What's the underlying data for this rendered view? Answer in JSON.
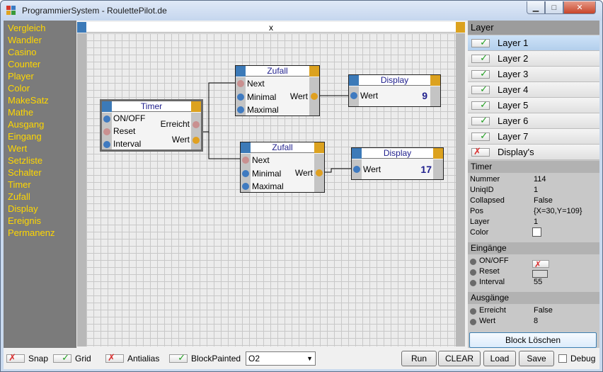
{
  "window": {
    "title": "ProgrammierSystem - RoulettePilot.de",
    "min": "▁",
    "max": "□",
    "close": "✕"
  },
  "palette": [
    "Vergleich",
    "Wandler",
    "Casino",
    "Counter",
    "Player",
    "Color",
    "MakeSatz",
    "Mathe",
    "Ausgang",
    "Eingang",
    "Wert",
    "Setzliste",
    "Schalter",
    "Timer",
    "Zufall",
    "Display",
    "Ereignis",
    "Permanenz"
  ],
  "canvas": {
    "header": "x"
  },
  "blocks": {
    "timer": {
      "title": "Timer",
      "in1": "ON/OFF",
      "in2": "Reset",
      "in3": "Interval",
      "out1": "Erreicht",
      "out2": "Wert"
    },
    "zufall1": {
      "title": "Zufall",
      "in1": "Next",
      "in2": "Minimal",
      "in3": "Maximal",
      "out1": "Wert"
    },
    "zufall2": {
      "title": "Zufall",
      "in1": "Next",
      "in2": "Minimal",
      "in3": "Maximal",
      "out1": "Wert"
    },
    "display1": {
      "title": "Display",
      "in1": "Wert",
      "value": "9"
    },
    "display2": {
      "title": "Display",
      "in1": "Wert",
      "value": "17"
    }
  },
  "layers": {
    "header": "Layer",
    "items": [
      "Layer 1",
      "Layer 2",
      "Layer 3",
      "Layer 4",
      "Layer 5",
      "Layer 6",
      "Layer 7",
      "Display's"
    ],
    "checked": [
      true,
      true,
      true,
      true,
      true,
      true,
      true,
      false
    ]
  },
  "props": {
    "header": "Timer",
    "rows": [
      {
        "k": "Nummer",
        "v": "114"
      },
      {
        "k": "UniqID",
        "v": "1"
      },
      {
        "k": "Collapsed",
        "v": "False"
      },
      {
        "k": "Pos",
        "v": "{X=30,Y=109}"
      },
      {
        "k": "Layer",
        "v": "1"
      },
      {
        "k": "Color",
        "v": ""
      }
    ],
    "inputs_header": "Eingänge",
    "inputs": [
      {
        "k": "ON/OFF",
        "v": ""
      },
      {
        "k": "Reset",
        "v": ""
      },
      {
        "k": "Interval",
        "v": "55"
      }
    ],
    "outputs_header": "Ausgänge",
    "outputs": [
      {
        "k": "Erreicht",
        "v": "False"
      },
      {
        "k": "Wert",
        "v": "8"
      }
    ],
    "delete_label": "Block Löschen"
  },
  "toolbar": {
    "snap": "Snap",
    "grid": "Grid",
    "antialias": "Antialias",
    "blockpainted": "BlockPainted",
    "combo": "O2",
    "run": "Run",
    "clear": "CLEAR",
    "load": "Load",
    "save": "Save",
    "debug": "Debug"
  },
  "icons": {
    "check": "✓",
    "cross": "✗",
    "dropdown": "▼"
  }
}
